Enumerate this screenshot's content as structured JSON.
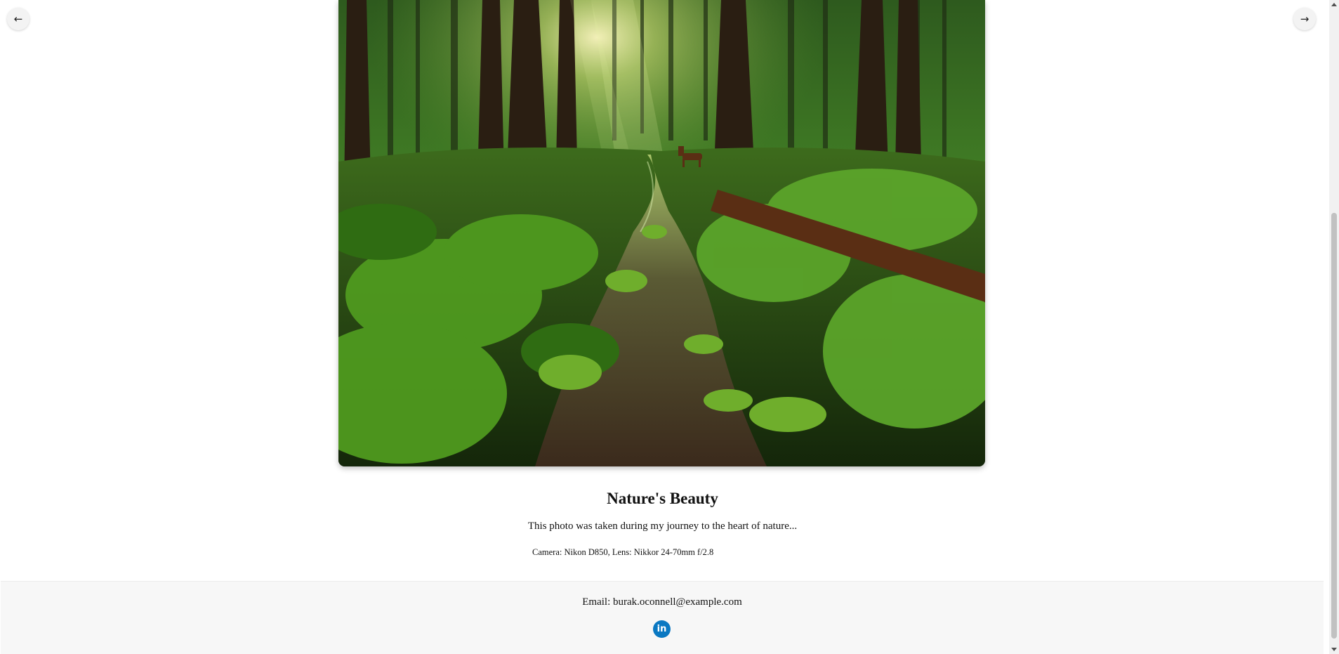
{
  "nav": {
    "prev_label": "←",
    "next_label": "→"
  },
  "photo": {
    "title": "Nature's Beauty",
    "description": "This photo was taken during my journey to the heart of nature...",
    "meta": "Camera: Nikon D850, Lens: Nikkor 24-70mm f/2.8"
  },
  "footer": {
    "email": "Email: burak.oconnell@example.com",
    "linkedin_icon": "linkedin-icon",
    "linkedin_label": "in",
    "linkedin_color": "#0a78c2"
  }
}
